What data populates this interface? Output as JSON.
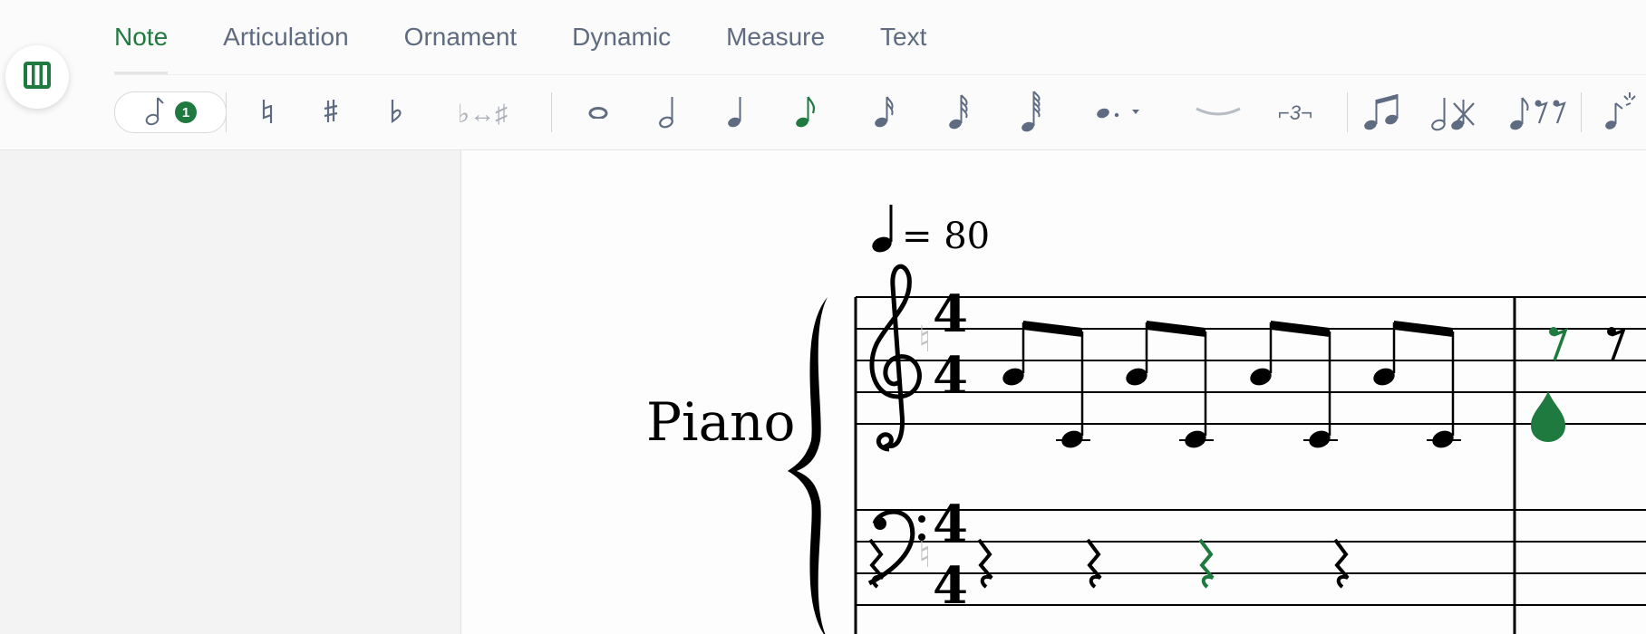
{
  "tabs": [
    "Note",
    "Articulation",
    "Ornament",
    "Dynamic",
    "Measure",
    "Text"
  ],
  "active_tab": "Note",
  "toolbar": {
    "voice_count": "1",
    "triplet_label": "⌐3¬",
    "accidental_swap": "♭↔♯"
  },
  "score": {
    "tempo_value": "= 80",
    "instrument": "Piano",
    "time_signature_top": "4",
    "time_signature_bottom": "4"
  },
  "colors": {
    "accent": "#1f7a3f",
    "tab_text": "#5f6b80",
    "icon_gray": "#5f6b80"
  }
}
